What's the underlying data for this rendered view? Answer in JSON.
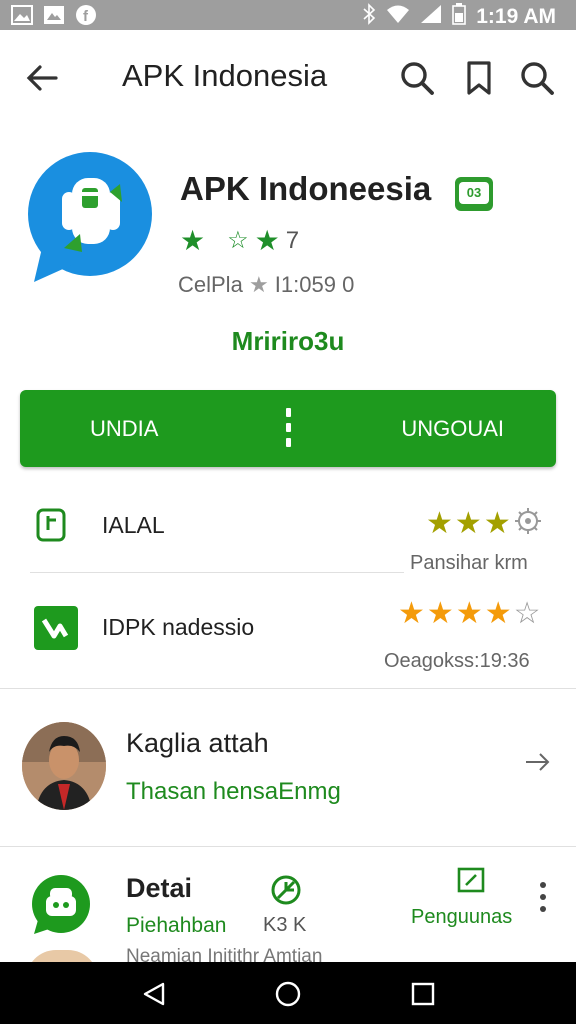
{
  "status_bar": {
    "time": "1:19 AM",
    "left_icons": [
      "image-icon",
      "photo-icon",
      "facebook-icon"
    ],
    "right_icons": [
      "bluetooth-icon",
      "wifi-icon",
      "signal-icon",
      "battery-icon"
    ]
  },
  "app_bar": {
    "title": "APK Indonesia",
    "icons": [
      "back-arrow-icon",
      "search-icon",
      "bookmark-icon",
      "search-icon"
    ]
  },
  "app": {
    "name": "APK Indoneesia",
    "badge": "03",
    "rating_text": "7",
    "meta_left": "CelPla",
    "meta_right": "I1:059 0",
    "subtitle": "Mririro3u",
    "colors": {
      "brand_green": "#1e9a1e",
      "logo_blue": "#1a8fe0",
      "star_green": "#1f8f2a"
    }
  },
  "actions": {
    "left_label": "UNDIA",
    "right_label": "UNGOUAI"
  },
  "rows": [
    {
      "label": "IALAL",
      "stars_filled": 3,
      "stars_total": 4,
      "sub": "Pansihar krm",
      "star_color": "#a3a000"
    },
    {
      "label": "IDPK nadessio",
      "stars_filled": 4,
      "stars_total": 5,
      "sub": "Oeagokss:19:36",
      "star_color": "#f49b0b"
    }
  ],
  "developer": {
    "name": "Kaglia attah",
    "sub": "Thasan hensaEnmg"
  },
  "details": {
    "title": "Detai",
    "sub": "Piehahban",
    "desc": "Neamian Initithr Amtian",
    "size_label": "K3 K",
    "users_label": "Penguunas"
  },
  "nav": {
    "icons": [
      "back-triangle-icon",
      "home-circle-icon",
      "recents-square-icon"
    ]
  }
}
